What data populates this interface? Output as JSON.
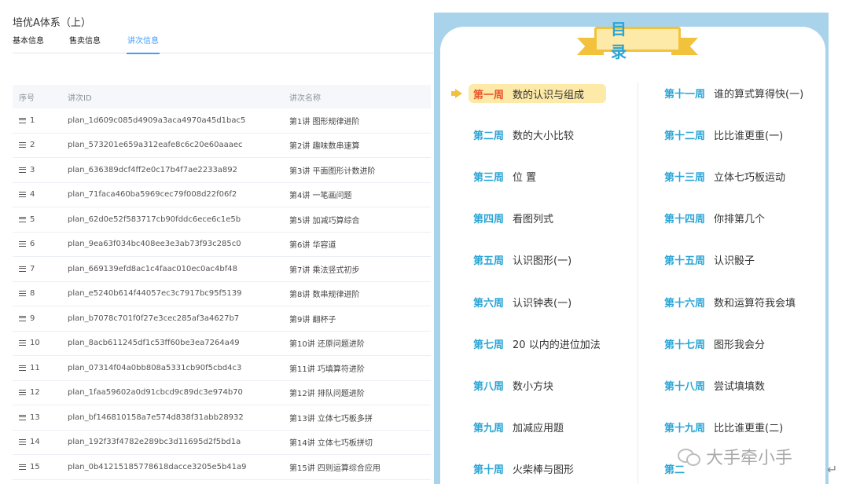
{
  "course_title": "培优A体系（上）",
  "tabs": [
    "基本信息",
    "售卖信息",
    "讲次信息"
  ],
  "active_tab": "讲次信息",
  "table": {
    "headers": [
      "序号",
      "讲次ID",
      "讲次名称"
    ],
    "rows": [
      {
        "idx": "1",
        "id": "plan_1d609c085d4909a3aca4970a45d1bac5",
        "name": "第1讲 图形规律进阶"
      },
      {
        "idx": "2",
        "id": "plan_573201e659a312eafe8c6c20e60aaaec",
        "name": "第2讲 趣味数串速算"
      },
      {
        "idx": "3",
        "id": "plan_636389dcf4ff2e0c17b4f7ae2233a892",
        "name": "第3讲 平面图形计数进阶"
      },
      {
        "idx": "4",
        "id": "plan_71faca460ba5969cec79f008d22f06f2",
        "name": "第4讲 一笔画问题"
      },
      {
        "idx": "5",
        "id": "plan_62d0e52f583717cb90fddc6ece6c1e5b",
        "name": "第5讲 加减巧算综合"
      },
      {
        "idx": "6",
        "id": "plan_9ea63f034bc408ee3e3ab73f93c285c0",
        "name": "第6讲 华容道"
      },
      {
        "idx": "7",
        "id": "plan_669139efd8ac1c4faac010ec0ac4bf48",
        "name": "第7讲 乘法竖式初步"
      },
      {
        "idx": "8",
        "id": "plan_e5240b614f44057ec3c7917bc95f5139",
        "name": "第8讲 数串规律进阶"
      },
      {
        "idx": "9",
        "id": "plan_b7078c701f0f27e3cec285af3a4627b7",
        "name": "第9讲 翻杯子"
      },
      {
        "idx": "10",
        "id": "plan_8acb611245df1c53ff60be3ea7264a49",
        "name": "第10讲 还原问题进阶"
      },
      {
        "idx": "11",
        "id": "plan_07314f04a0bb808a5331cb90f5cbd4c3",
        "name": "第11讲 巧填算符进阶"
      },
      {
        "idx": "12",
        "id": "plan_1faa59602a0d91cbcd9c89dc3e974b70",
        "name": "第12讲 排队问题进阶"
      },
      {
        "idx": "13",
        "id": "plan_bf146810158a7e574d838f31abb28932",
        "name": "第13讲 立体七巧板多拼"
      },
      {
        "idx": "14",
        "id": "plan_192f33f4782e289bc3d11695d2f5bd1a",
        "name": "第14讲 立体七巧板拼切"
      },
      {
        "idx": "15",
        "id": "plan_0b41215185778618dacce3205e5b41a9",
        "name": "第15讲 四则运算综合应用"
      }
    ]
  },
  "toc": {
    "title": "目 录",
    "left": [
      {
        "week": "第一周",
        "topic": "数的认识与组成",
        "active": true
      },
      {
        "week": "第二周",
        "topic": "数的大小比较"
      },
      {
        "week": "第三周",
        "topic": "位  置"
      },
      {
        "week": "第四周",
        "topic": "看图列式"
      },
      {
        "week": "第五周",
        "topic": "认识图形(一)"
      },
      {
        "week": "第六周",
        "topic": "认识钟表(一)"
      },
      {
        "week": "第七周",
        "topic": "20 以内的进位加法"
      },
      {
        "week": "第八周",
        "topic": "数小方块"
      },
      {
        "week": "第九周",
        "topic": "加减应用题"
      },
      {
        "week": "第十周",
        "topic": "火柴棒与图形"
      }
    ],
    "right": [
      {
        "week": "第十一周",
        "topic": "谁的算式算得快(一)"
      },
      {
        "week": "第十二周",
        "topic": "比比谁更重(一)"
      },
      {
        "week": "第十三周",
        "topic": "立体七巧板运动"
      },
      {
        "week": "第十四周",
        "topic": "你排第几个"
      },
      {
        "week": "第十五周",
        "topic": "认识骰子"
      },
      {
        "week": "第十六周",
        "topic": "数和运算符我会填"
      },
      {
        "week": "第十七周",
        "topic": "图形我会分"
      },
      {
        "week": "第十八周",
        "topic": "尝试填填数"
      },
      {
        "week": "第十九周",
        "topic": "比比谁更重(二)"
      },
      {
        "week": "第二",
        "topic": ""
      }
    ]
  },
  "watermark": "大手牵小手",
  "colors": {
    "accent": "#409eff",
    "toc_blue": "#2aa5d6",
    "toc_active_week": "#e8542c",
    "highlight": "#fde9a8",
    "frame": "#a8d3ea"
  }
}
